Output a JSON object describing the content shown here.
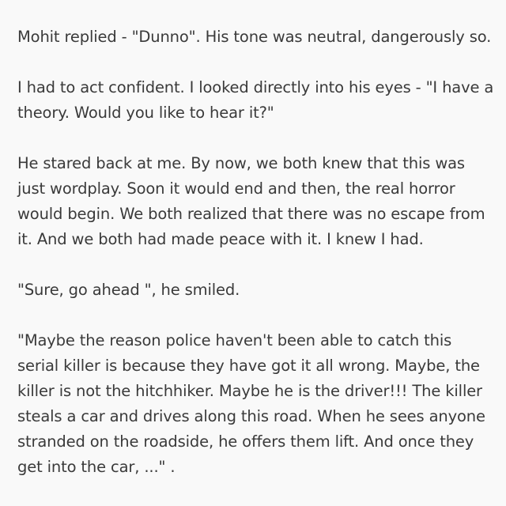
{
  "story": {
    "paragraphs": [
      "Mohit replied - \"Dunno\". His tone was neutral, dangerously so.",
      "I had to act confident. I looked directly into his eyes - \"I have a theory. Would you like to hear it?\"",
      "He stared back at me. By now, we both knew that this was just wordplay. Soon it would end and then, the real horror would begin. We both realized that there was no escape from it. And we both had made peace with it. I knew I had.",
      "\"Sure, go ahead \", he smiled.",
      "\"Maybe the reason police haven't been able to catch this serial killer is because they have got it all wrong. Maybe, the killer is not the hitchhiker. Maybe he is the driver!!! The killer steals a car and drives along this road. When he sees anyone stranded on the roadside, he offers them lift. And once they get into the car, ...\" ."
    ]
  }
}
